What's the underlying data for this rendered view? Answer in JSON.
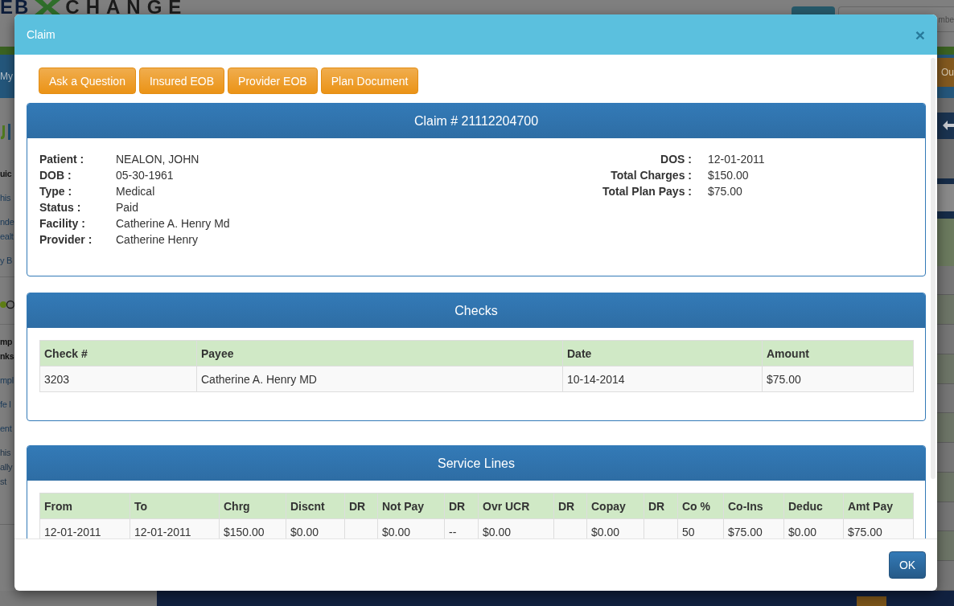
{
  "background": {
    "logo": {
      "start": "EB",
      "end": "CHANGE"
    },
    "search": {
      "placeholder": "mbe"
    },
    "nav": {
      "label": "My",
      "button": "Ou"
    },
    "sidebar_groups": [
      {
        "items": [
          {
            "kind": "heading",
            "lines": [
              "uic"
            ]
          },
          {
            "kind": "link",
            "lines": [
              "his"
            ]
          },
          {
            "kind": "link",
            "lines": [
              "nde",
              "ealt"
            ]
          },
          {
            "kind": "link",
            "lines": [
              "y B"
            ]
          }
        ]
      },
      {
        "items": [
          {
            "kind": "heading",
            "lines": [
              "mp",
              "nks"
            ]
          },
          {
            "kind": "link",
            "lines": [
              "mpl"
            ]
          },
          {
            "kind": "link",
            "lines": [
              "fe l"
            ]
          },
          {
            "kind": "link",
            "lines": [
              "ent"
            ]
          },
          {
            "kind": "text",
            "lines": [
              "his",
              "ally",
              "st"
            ]
          }
        ]
      }
    ]
  },
  "modal": {
    "title": "Claim",
    "close": "×",
    "actions": [
      "Ask a Question",
      "Insured EOB",
      "Provider EOB",
      "Plan Document"
    ],
    "claim": {
      "title": "Claim # 21112204700",
      "left_fields": [
        {
          "label": "Patient :",
          "value": "NEALON, JOHN"
        },
        {
          "label": "DOB :",
          "value": "05-30-1961"
        },
        {
          "label": "Type :",
          "value": "Medical"
        },
        {
          "label": "Status :",
          "value": "Paid"
        },
        {
          "label": "Facility :",
          "value": "Catherine A. Henry Md"
        },
        {
          "label": "Provider :",
          "value": "Catherine Henry"
        }
      ],
      "right_fields": [
        {
          "label": "DOS :",
          "value": "12-01-2011"
        },
        {
          "label": "Total Charges :",
          "value": "$150.00"
        },
        {
          "label": "Total Plan Pays :",
          "value": "$75.00"
        }
      ]
    },
    "checks": {
      "title": "Checks",
      "columns": [
        "Check #",
        "Payee",
        "Date",
        "Amount"
      ],
      "rows": [
        [
          "3203",
          "Catherine A. Henry MD",
          "10-14-2014",
          "$75.00"
        ]
      ]
    },
    "service_lines": {
      "title": "Service Lines",
      "columns": [
        "From",
        "To",
        "Chrg",
        "Discnt",
        "DR",
        "Not Pay",
        "DR",
        "Ovr UCR",
        "DR",
        "Copay",
        "DR",
        "Co %",
        "Co-Ins",
        "Deduc",
        "Amt Pay"
      ],
      "rows": [
        [
          "12-01-2011",
          "12-01-2011",
          "$150.00",
          "$0.00",
          null,
          "$0.00",
          "--",
          "$0.00",
          null,
          "$0.00",
          null,
          "50",
          "$75.00",
          "$0.00",
          "$75.00"
        ]
      ]
    },
    "ok_button": "OK"
  }
}
